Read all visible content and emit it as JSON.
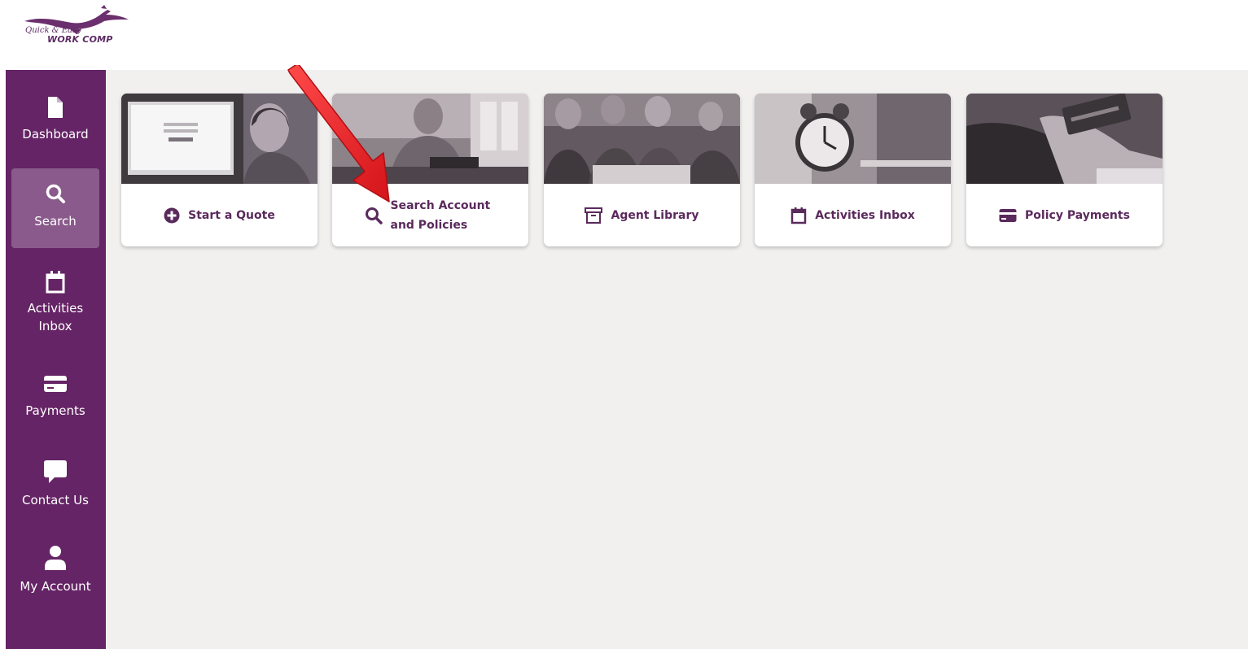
{
  "logo": {
    "script_text": "Quick & Easy",
    "main_text": "WORK COMP"
  },
  "sidebar": {
    "items": [
      {
        "label": "Dashboard",
        "icon": "file-icon"
      },
      {
        "label": "Search",
        "icon": "search-icon",
        "active": true
      },
      {
        "label": "Activities Inbox",
        "icon": "calendar-icon"
      },
      {
        "label": "Payments",
        "icon": "credit-card-icon"
      },
      {
        "label": "Contact Us",
        "icon": "chat-icon"
      },
      {
        "label": "My Account",
        "icon": "user-icon"
      }
    ]
  },
  "cards": [
    {
      "label": "Start a Quote",
      "icon": "plus-circle-icon"
    },
    {
      "label": "Search Account and Policies",
      "icon": "search-icon"
    },
    {
      "label": "Agent Library",
      "icon": "archive-icon"
    },
    {
      "label": "Activities Inbox",
      "icon": "calendar-icon"
    },
    {
      "label": "Policy Payments",
      "icon": "credit-card-icon"
    }
  ],
  "colors": {
    "brand_purple": "#652465",
    "active_nav": "#8a5a8c",
    "card_text": "#5a2a5c",
    "content_bg": "#f1f0ef",
    "annotation_arrow": "#e8262b"
  }
}
